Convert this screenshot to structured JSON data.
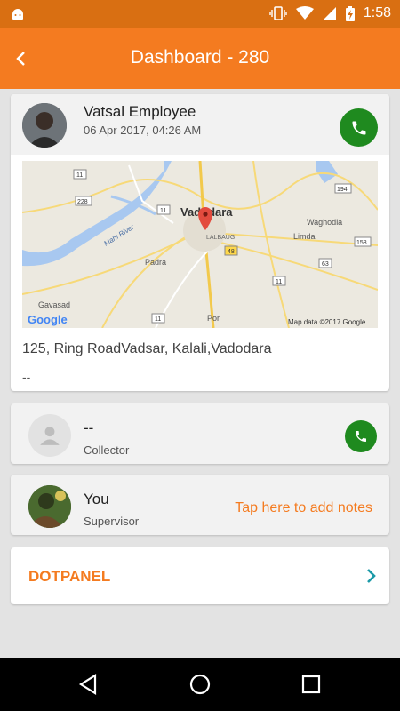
{
  "status_bar": {
    "time": "1:58",
    "icons": [
      "android-icon",
      "vibrate-icon",
      "wifi-icon",
      "signal-icon",
      "battery-charging-icon"
    ]
  },
  "app_bar": {
    "title": "Dashboard - 280",
    "back_icon": "back-arrow-icon"
  },
  "employee": {
    "name": "Vatsal Employee",
    "timestamp": "06 Apr 2017, 04:26 AM",
    "address": "125, Ring RoadVadsar, Kalali,Vadodara",
    "note": "--",
    "map": {
      "city_label": "Vadodara",
      "area_label": "LALBAUG",
      "places": [
        "Waghodia",
        "Limda",
        "Padra",
        "Gavasad",
        "Por"
      ],
      "river_label": "Mahi River",
      "highways": [
        "11",
        "228",
        "11",
        "194",
        "158",
        "48",
        "63",
        "11",
        "11"
      ],
      "attribution": "Map data ©2017 Google",
      "logo": "Google"
    }
  },
  "collector": {
    "name": "--",
    "role": "Collector"
  },
  "supervisor": {
    "name": "You",
    "role": "Supervisor",
    "notes_cta": "Tap here to add notes"
  },
  "company": {
    "title": "DOTPANEL"
  },
  "colors": {
    "primary": "#f47b20",
    "primary_dark": "#d96f12",
    "call_green": "#1f8a1f",
    "chevron": "#1c9aa8"
  },
  "nav_bar": {
    "icons": [
      "nav-back-icon",
      "nav-home-icon",
      "nav-recents-icon"
    ]
  }
}
